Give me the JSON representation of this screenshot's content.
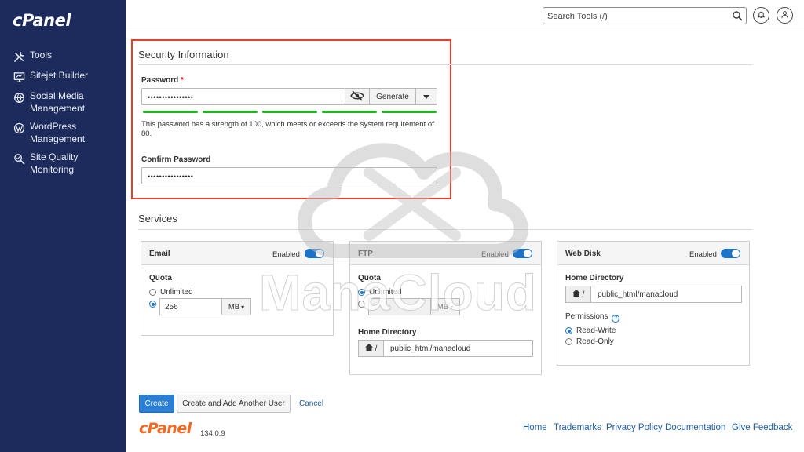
{
  "sidebar": {
    "logo": "cPanel",
    "items": [
      {
        "label": "Tools",
        "icon": "tools-icon"
      },
      {
        "label": "Sitejet Builder",
        "icon": "monitor-icon"
      },
      {
        "label": "Social Media Management",
        "icon": "globe-icon"
      },
      {
        "label": "WordPress Management",
        "icon": "wordpress-icon"
      },
      {
        "label": "Site Quality Monitoring",
        "icon": "magnifier-icon"
      }
    ]
  },
  "header": {
    "search_placeholder": "Search Tools (/)"
  },
  "security": {
    "title": "Security Information",
    "password_label": "Password",
    "required_mark": "*",
    "password_value": "••••••••••••••••",
    "generate_label": "Generate",
    "strength_text": "This password has a strength of 100, which meets or exceeds the system requirement of 80.",
    "confirm_label": "Confirm Password",
    "confirm_value": "••••••••••••••••",
    "strength_color": "#22b422",
    "highlight_color": "#e53e2a"
  },
  "services": {
    "title": "Services",
    "email": {
      "title": "Email",
      "enabled_label": "Enabled",
      "quota_label": "Quota",
      "unlimited_label": "Unlimited",
      "quota_value": "256",
      "unit": "MB",
      "selected": "custom"
    },
    "ftp": {
      "title": "FTP",
      "enabled_label": "Enabled",
      "quota_label": "Quota",
      "unlimited_label": "Unlimited",
      "quota_value": "",
      "unit": "MB",
      "selected": "unlimited",
      "home_label": "Home Directory",
      "home_prefix": "/",
      "home_value": "public_html/manacloud"
    },
    "webdisk": {
      "title": "Web Disk",
      "enabled_label": "Enabled",
      "home_label": "Home Directory",
      "home_prefix": "/",
      "home_value": "public_html/manacloud",
      "permissions_label": "Permissions",
      "options": [
        "Read-Write",
        "Read-Only"
      ],
      "selected": "Read-Write"
    }
  },
  "actions": {
    "create": "Create",
    "create_another": "Create and Add Another User",
    "cancel": "Cancel"
  },
  "footer": {
    "logo": "cPanel",
    "version": "134.0.9",
    "links": [
      "Home",
      "Trademarks",
      "Privacy Policy",
      "Documentation",
      "Give Feedback"
    ]
  },
  "watermark": {
    "text": "ManaCloud"
  },
  "colors": {
    "sidebar_bg": "#1d2b5c",
    "accent": "#1b74c9",
    "link": "#1f5fa8",
    "brand_orange": "#f26a22"
  }
}
